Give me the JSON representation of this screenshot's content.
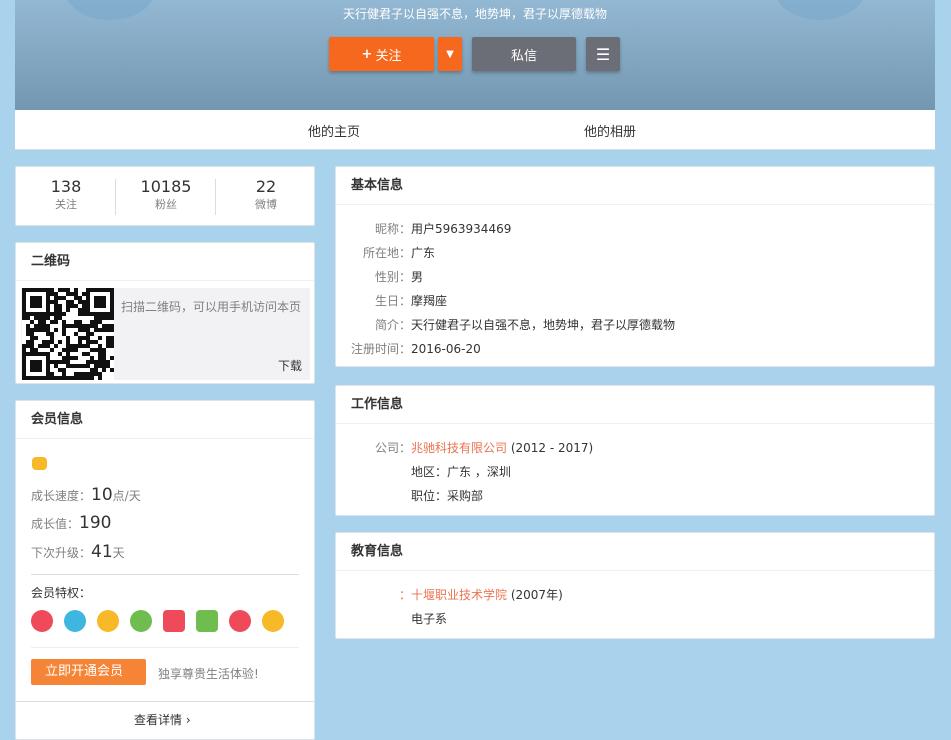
{
  "header": {
    "motto": "天行健君子以自强不息，地势坤，君子以厚德载物",
    "follow": "关注",
    "message": "私信"
  },
  "nav": {
    "home": "他的主页",
    "album": "他的相册"
  },
  "stats": [
    {
      "value": "138",
      "label": "关注"
    },
    {
      "value": "10185",
      "label": "粉丝"
    },
    {
      "value": "22",
      "label": "微博"
    }
  ],
  "qr": {
    "title": "二维码",
    "hint": "扫描二维码，可以用手机访问本页",
    "download": "下载"
  },
  "member": {
    "title": "会员信息",
    "speed_label": "成长速度：",
    "speed_value": "10",
    "speed_unit": "点/天",
    "growth_label": "成长值：",
    "growth_value": "190",
    "next_label": "下次升级：",
    "next_value": "41",
    "next_unit": "天",
    "privileges_label": "会员特权：",
    "privilege_colors": [
      "#ee4a5a",
      "#3fb6e0",
      "#f7b928",
      "#6ebd4e",
      "#ee4a5a",
      "#6ebd4e",
      "#ee4a5a",
      "#f7b928"
    ],
    "open_button": "立即开通会员",
    "slogan": "独享尊贵生活体验!",
    "details": "查看详情"
  },
  "basic": {
    "title": "基本信息",
    "rows": [
      {
        "label": "昵称：",
        "value": "用户5963934469"
      },
      {
        "label": "所在地：",
        "value": "广东"
      },
      {
        "label": "性别：",
        "value": "男"
      },
      {
        "label": "生日：",
        "value": "摩羯座"
      },
      {
        "label": "简介：",
        "value": "天行健君子以自强不息，地势坤，君子以厚德载物"
      },
      {
        "label": "注册时间：",
        "value": "2016-06-20"
      }
    ]
  },
  "work": {
    "title": "工作信息",
    "company_label": "公司：",
    "company": "兆驰科技有限公司",
    "years": " (2012 - 2017)",
    "region": "地区：广东 ，深圳",
    "position": "职位：采购部"
  },
  "edu": {
    "title": "教育信息",
    "prefix": "：",
    "school": "十堰职业技术学院",
    "year": " (2007年)",
    "dept": "电子系"
  }
}
